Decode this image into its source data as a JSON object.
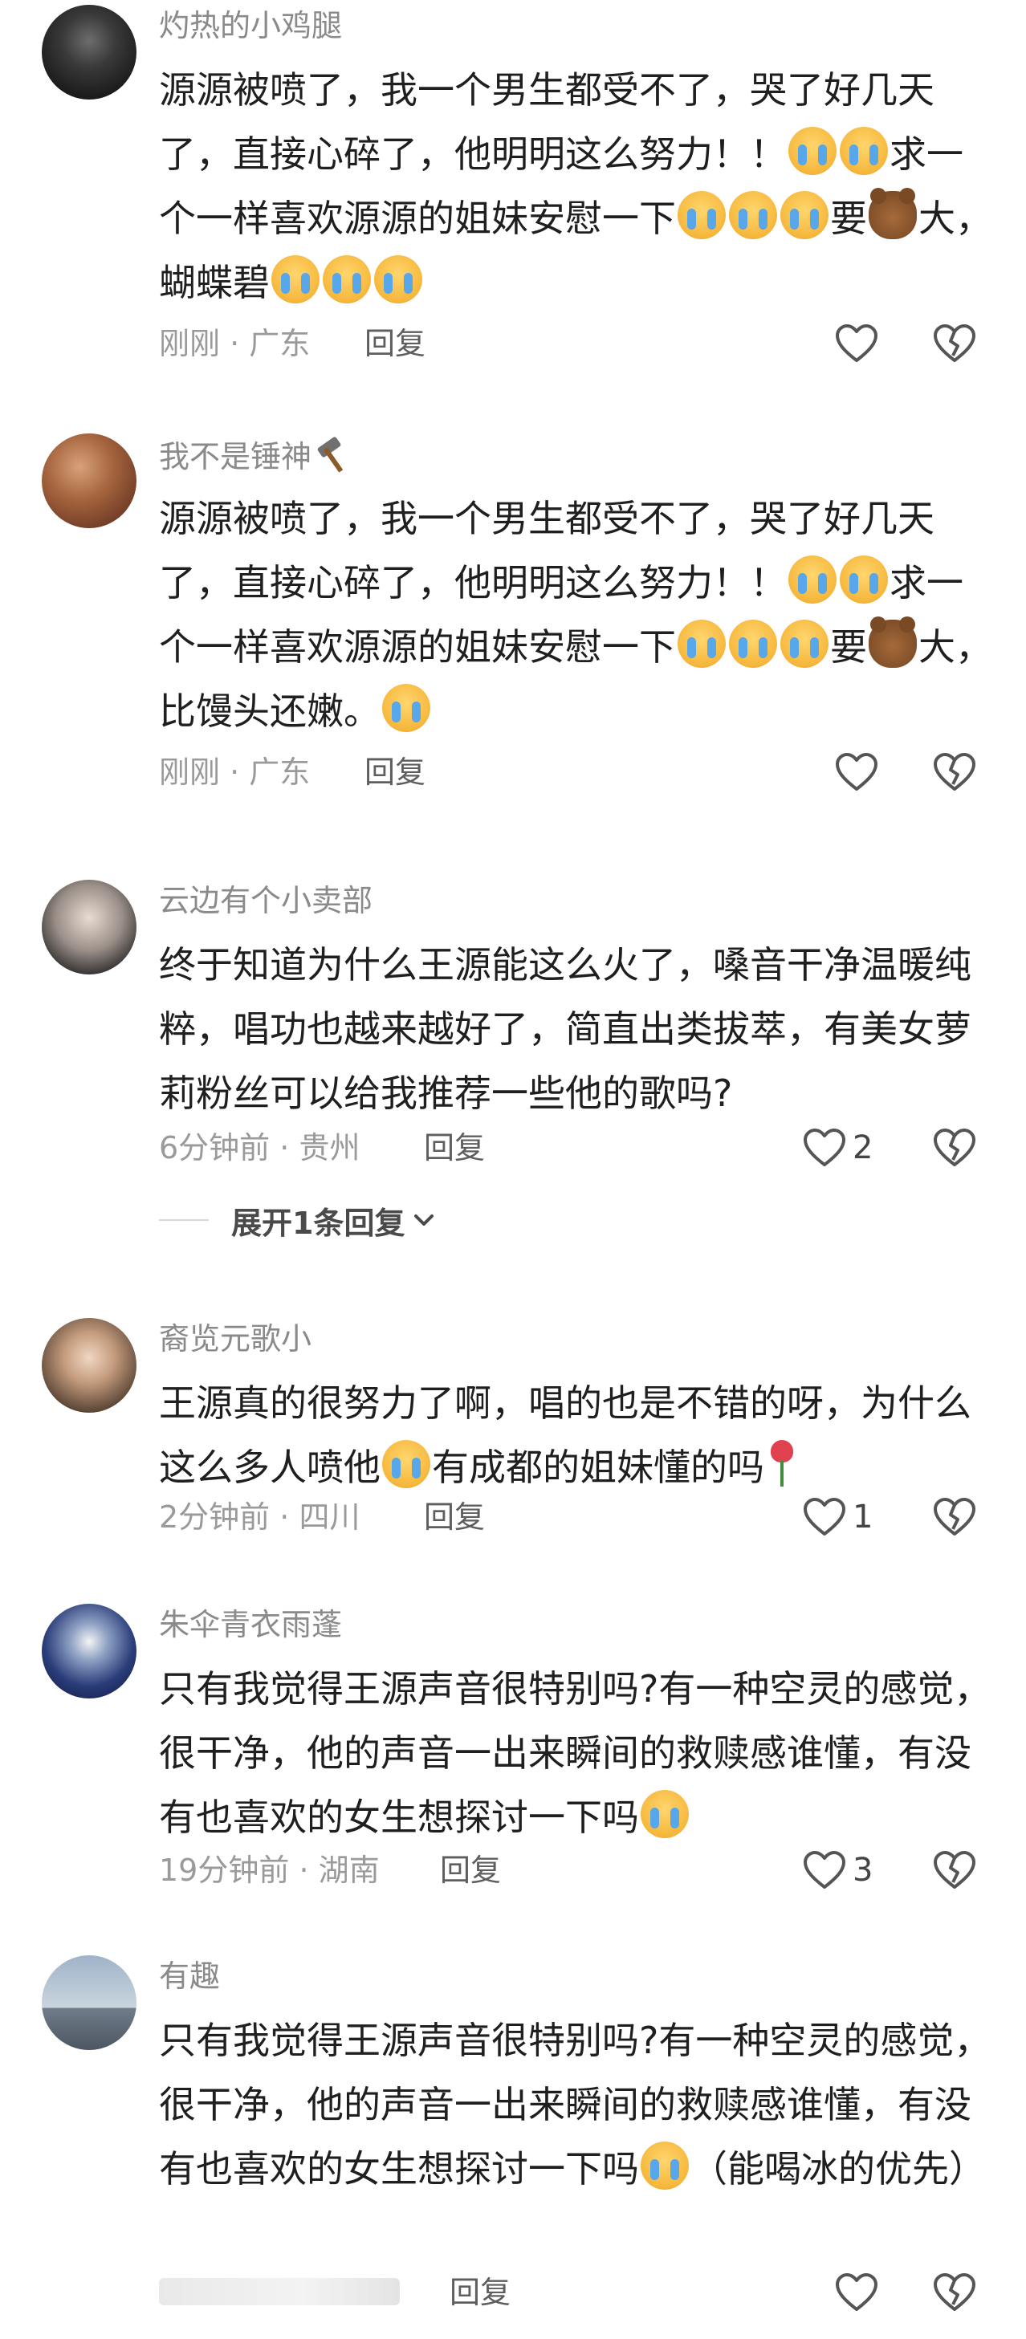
{
  "comments": [
    {
      "username": "灼热的小鸡腿",
      "text_parts": [
        "源源被喷了，我一个男生都受不了，哭了好几天了，直接心碎了，他明明这么努力！！",
        "求一个一样喜欢源源的姐妹安慰一下",
        "要",
        "大，蝴蝶碧"
      ],
      "time": "刚刚",
      "location": "广东",
      "reply_label": "回复",
      "likes": ""
    },
    {
      "username": "我不是锤神",
      "text_parts": [
        "源源被喷了，我一个男生都受不了，哭了好几天了，直接心碎了，他明明这么努力！！",
        "求一个一样喜欢源源的姐妹安慰一下",
        "要",
        "大，比馒头还嫩。"
      ],
      "time": "刚刚",
      "location": "广东",
      "reply_label": "回复",
      "likes": ""
    },
    {
      "username": "云边有个小卖部",
      "text": "终于知道为什么王源能这么火了，嗓音干净温暖纯粹，唱功也越来越好了，简直出类拔萃，有美女萝莉粉丝可以给我推荐一些他的歌吗?",
      "time": "6分钟前",
      "location": "贵州",
      "reply_label": "回复",
      "likes": "2",
      "expand_label": "展开1条回复"
    },
    {
      "username": "裔览元歌小",
      "text_parts": [
        "王源真的很努力了啊，唱的也是不错的呀，为什么这么多人喷他",
        "有成都的姐妹懂的吗"
      ],
      "time": "2分钟前",
      "location": "四川",
      "reply_label": "回复",
      "likes": "1"
    },
    {
      "username": "朱伞青衣雨蓬",
      "text_parts": [
        "只有我觉得王源声音很特别吗?有一种空灵的感觉，很干净，他的声音一出来瞬间的救赎感谁懂，有没有也喜欢的女生想探讨一下吗"
      ],
      "time": "19分钟前",
      "location": "湖南",
      "reply_label": "回复",
      "likes": "3"
    },
    {
      "username": "有趣",
      "text_parts": [
        "只有我觉得王源声音很特别吗?有一种空灵的感觉，很干净，他的声音一出来瞬间的救赎感谁懂，有没有也喜欢的女生想探讨一下吗",
        "（能喝冰的优先）"
      ],
      "reply_label": "回复",
      "likes": ""
    }
  ],
  "separator": " · ",
  "colors": {
    "meta": "#9a9a9a",
    "text": "#1f1f1f",
    "icon": "#555555"
  }
}
